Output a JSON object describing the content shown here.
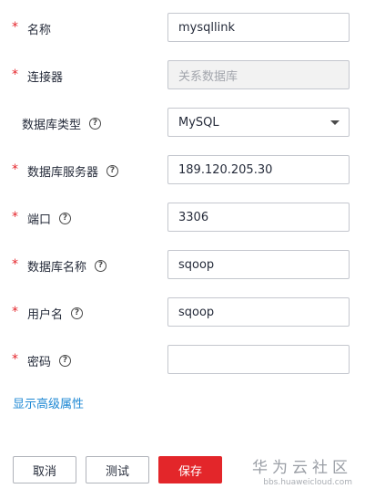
{
  "form": {
    "name": {
      "label": "名称",
      "value": "mysqllink",
      "required": true
    },
    "connector": {
      "label": "连接器",
      "value": "关系数据库",
      "required": true
    },
    "db_type": {
      "label": "数据库类型",
      "value": "MySQL",
      "help": "?"
    },
    "db_server": {
      "label": "数据库服务器",
      "value": "189.120.205.30",
      "required": true,
      "help": "?"
    },
    "port": {
      "label": "端口",
      "value": "3306",
      "required": true,
      "help": "?"
    },
    "db_name": {
      "label": "数据库名称",
      "value": "sqoop",
      "required": true,
      "help": "?"
    },
    "username": {
      "label": "用户名",
      "value": "sqoop",
      "required": true,
      "help": "?"
    },
    "password": {
      "label": "密码",
      "value": "",
      "required": true,
      "help": "?"
    },
    "required_mark": "*"
  },
  "advanced_link": "显示高级属性",
  "buttons": {
    "cancel": "取消",
    "test": "测试",
    "save": "保存"
  },
  "watermark": {
    "title": "华为云社区",
    "url": "bbs.huaweicloud.com"
  },
  "colors": {
    "required": "#e5252b",
    "link": "#1e88d4",
    "primary": "#e3262a"
  }
}
